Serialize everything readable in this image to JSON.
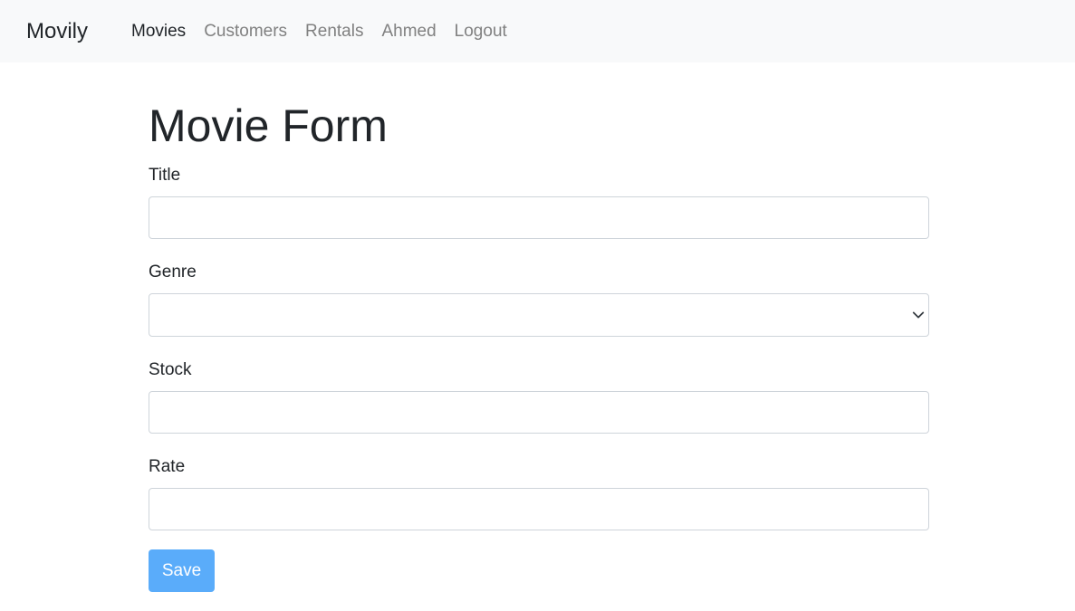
{
  "navbar": {
    "brand": "Movily",
    "links": [
      "Movies",
      "Customers",
      "Rentals",
      "Ahmed",
      "Logout"
    ],
    "active_index": 0
  },
  "form": {
    "title": "Movie Form",
    "fields": {
      "title": {
        "label": "Title",
        "value": ""
      },
      "genre": {
        "label": "Genre",
        "selected": ""
      },
      "stock": {
        "label": "Stock",
        "value": ""
      },
      "rate": {
        "label": "Rate",
        "value": ""
      }
    },
    "save_label": "Save"
  },
  "colors": {
    "navbar_bg": "#f8f9fa",
    "save_button_bg": "#5aacfa",
    "nav_link_inactive": "#808080",
    "nav_link_active": "#212529"
  }
}
